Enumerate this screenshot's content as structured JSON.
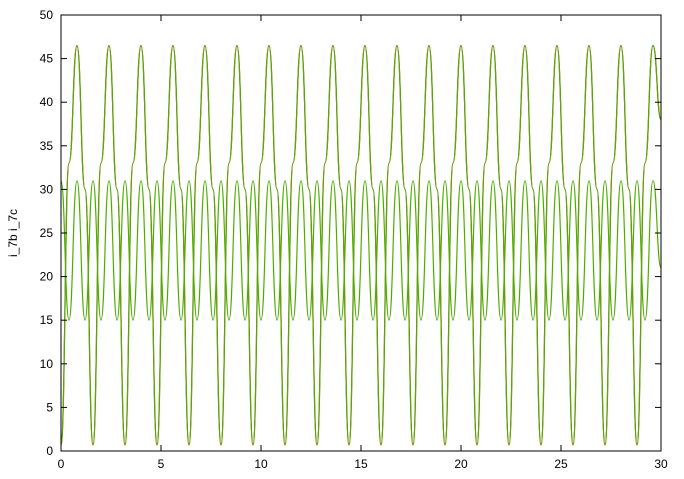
{
  "chart_data": {
    "type": "line",
    "title": "",
    "xlabel": "",
    "ylabel": "i_7b i_7c",
    "xlim": [
      0,
      30
    ],
    "ylim": [
      0,
      50
    ],
    "xticks": [
      0,
      5,
      10,
      15,
      20,
      25,
      30
    ],
    "yticks": [
      0,
      5,
      10,
      15,
      20,
      25,
      30,
      35,
      40,
      45,
      50
    ],
    "grid": false,
    "legend": "none",
    "series": [
      {
        "color": "#d62728",
        "x": [
          0,
          0.4,
          0.8,
          1.2,
          1.6,
          2.0,
          2.4,
          2.8,
          3.2,
          3.6,
          4.0,
          4.4,
          4.8,
          5.2,
          5.6,
          6.0,
          6.4,
          6.8,
          7.2,
          7.6,
          8.0,
          8.4,
          8.8,
          9.2,
          9.6,
          10.0,
          10.4,
          10.8,
          11.2,
          11.6,
          12.0,
          12.4,
          12.8,
          13.2,
          13.6,
          14.0,
          14.4,
          14.8,
          15.2,
          15.6,
          16.0,
          16.4,
          16.8,
          17.2,
          17.6,
          18.0,
          18.4,
          18.8,
          19.2,
          19.6,
          20.0,
          20.4,
          20.8,
          21.2,
          21.6,
          22.0,
          22.4,
          22.8,
          23.2,
          23.6,
          24.0,
          24.4,
          24.8,
          25.2,
          25.6,
          26.0,
          26.4,
          26.8,
          27.2,
          27.6,
          28.0,
          28.4,
          28.8,
          29.2,
          29.6,
          30.0
        ],
        "y": [
          0.7,
          33.0,
          46.5,
          30.0,
          0.7,
          33.0,
          46.5,
          30.0,
          0.7,
          33.0,
          46.5,
          30.0,
          0.7,
          33.0,
          46.5,
          30.0,
          0.7,
          33.0,
          46.5,
          30.0,
          0.7,
          33.0,
          46.5,
          30.0,
          0.7,
          33.0,
          46.5,
          30.0,
          0.7,
          33.0,
          46.5,
          30.0,
          0.7,
          33.0,
          46.5,
          30.0,
          0.7,
          33.0,
          46.5,
          30.0,
          0.7,
          33.0,
          46.5,
          30.0,
          0.7,
          33.0,
          46.5,
          30.0,
          0.7,
          33.0,
          46.5,
          30.0,
          0.7,
          33.0,
          46.5,
          30.0,
          0.7,
          33.0,
          46.5,
          30.0,
          0.7,
          33.0,
          46.5,
          30.0,
          0.7,
          33.0,
          46.5,
          30.0,
          0.7,
          33.0,
          46.5,
          30.0,
          0.7,
          33.0,
          46.5,
          38.0
        ]
      },
      {
        "color": "#4caf00",
        "x": [
          0,
          0.4,
          0.8,
          1.2,
          1.6,
          2.0,
          2.4,
          2.8,
          3.2,
          3.6,
          4.0,
          4.4,
          4.8,
          5.2,
          5.6,
          6.0,
          6.4,
          6.8,
          7.2,
          7.6,
          8.0,
          8.4,
          8.8,
          9.2,
          9.6,
          10.0,
          10.4,
          10.8,
          11.2,
          11.6,
          12.0,
          12.4,
          12.8,
          13.2,
          13.6,
          14.0,
          14.4,
          14.8,
          15.2,
          15.6,
          16.0,
          16.4,
          16.8,
          17.2,
          17.6,
          18.0,
          18.4,
          18.8,
          19.2,
          19.6,
          20.0,
          20.4,
          20.8,
          21.2,
          21.6,
          22.0,
          22.4,
          22.8,
          23.2,
          23.6,
          24.0,
          24.4,
          24.8,
          25.2,
          25.6,
          26.0,
          26.4,
          26.8,
          27.2,
          27.6,
          28.0,
          28.4,
          28.8,
          29.2,
          29.6,
          30.0
        ],
        "y": [
          31.0,
          15.0,
          31.0,
          15.0,
          31.0,
          15.0,
          31.0,
          15.0,
          31.0,
          15.0,
          31.0,
          15.0,
          31.0,
          15.0,
          31.0,
          15.0,
          31.0,
          15.0,
          31.0,
          15.0,
          31.0,
          15.0,
          31.0,
          15.0,
          31.0,
          15.0,
          31.0,
          15.0,
          31.0,
          15.0,
          31.0,
          15.0,
          31.0,
          15.0,
          31.0,
          15.0,
          31.0,
          15.0,
          31.0,
          15.0,
          31.0,
          15.0,
          31.0,
          15.0,
          31.0,
          15.0,
          31.0,
          15.0,
          31.0,
          15.0,
          31.0,
          15.0,
          31.0,
          15.0,
          31.0,
          15.0,
          31.0,
          15.0,
          31.0,
          15.0,
          31.0,
          15.0,
          31.0,
          15.0,
          31.0,
          15.0,
          31.0,
          15.0,
          31.0,
          15.0,
          31.0,
          15.0,
          31.0,
          15.0,
          31.0,
          21.0
        ]
      },
      {
        "color": "#4caf00",
        "x": [
          0,
          0.4,
          0.8,
          1.2,
          1.6,
          2.0,
          2.4,
          2.8,
          3.2,
          3.6,
          4.0,
          4.4,
          4.8,
          5.2,
          5.6,
          6.0,
          6.4,
          6.8,
          7.2,
          7.6,
          8.0,
          8.4,
          8.8,
          9.2,
          9.6,
          10.0,
          10.4,
          10.8,
          11.2,
          11.6,
          12.0,
          12.4,
          12.8,
          13.2,
          13.6,
          14.0,
          14.4,
          14.8,
          15.2,
          15.6,
          16.0,
          16.4,
          16.8,
          17.2,
          17.6,
          18.0,
          18.4,
          18.8,
          19.2,
          19.6,
          20.0,
          20.4,
          20.8,
          21.2,
          21.6,
          22.0,
          22.4,
          22.8,
          23.2,
          23.6,
          24.0,
          24.4,
          24.8,
          25.2,
          25.6,
          26.0,
          26.4,
          26.8,
          27.2,
          27.6,
          28.0,
          28.4,
          28.8,
          29.2,
          29.6,
          30.0
        ],
        "y": [
          0.7,
          33.0,
          46.5,
          30.0,
          0.7,
          33.0,
          46.5,
          30.0,
          0.7,
          33.0,
          46.5,
          30.0,
          0.7,
          33.0,
          46.5,
          30.0,
          0.7,
          33.0,
          46.5,
          30.0,
          0.7,
          33.0,
          46.5,
          30.0,
          0.7,
          33.0,
          46.5,
          30.0,
          0.7,
          33.0,
          46.5,
          30.0,
          0.7,
          33.0,
          46.5,
          30.0,
          0.7,
          33.0,
          46.5,
          30.0,
          0.7,
          33.0,
          46.5,
          30.0,
          0.7,
          33.0,
          46.5,
          30.0,
          0.7,
          33.0,
          46.5,
          30.0,
          0.7,
          33.0,
          46.5,
          30.0,
          0.7,
          33.0,
          46.5,
          30.0,
          0.7,
          33.0,
          46.5,
          30.0,
          0.7,
          33.0,
          46.5,
          30.0,
          0.7,
          33.0,
          46.5,
          30.0,
          0.7,
          33.0,
          46.5,
          38.0
        ]
      }
    ]
  }
}
